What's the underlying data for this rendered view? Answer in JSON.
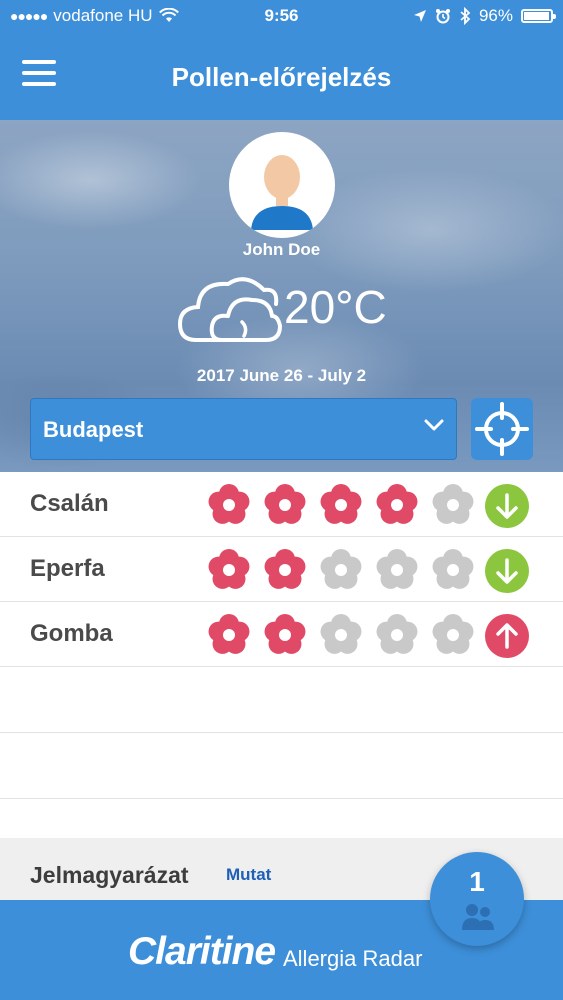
{
  "status_bar": {
    "carrier": "vodafone HU",
    "time": "9:56",
    "battery": "96%",
    "signal_dots": "●●●●●"
  },
  "header": {
    "title": "Pollen-előrejelzés",
    "menu_icon": "hamburger-menu-icon"
  },
  "profile": {
    "name": "John Doe",
    "avatar_icon": "user-avatar-icon"
  },
  "weather": {
    "icon": "cloud-icon",
    "temperature": "20°C",
    "date_range": "2017 June 26 - July 2"
  },
  "location": {
    "selected_city": "Budapest",
    "locate_icon": "crosshair-icon"
  },
  "pollen": {
    "items": [
      {
        "name": "Csalán",
        "level": 4,
        "max_level": 5,
        "trend": "down"
      },
      {
        "name": "Eperfa",
        "level": 2,
        "max_level": 5,
        "trend": "down"
      },
      {
        "name": "Gomba",
        "level": 2,
        "max_level": 5,
        "trend": "up"
      }
    ],
    "colors": {
      "active_flower": "#e04a66",
      "inactive_flower": "#c9c9c9",
      "trend_down": "#8cc63f",
      "trend_up": "#e04a66"
    }
  },
  "legend": {
    "title": "Jelmagyarázat",
    "toggle_label": "Mutat"
  },
  "footer": {
    "brand": "Claritine",
    "product": "Allergia Radar"
  },
  "family": {
    "count": "1",
    "icon": "people-icon"
  },
  "colors": {
    "primary": "#3d8fd9",
    "text": "#4a4a4a"
  }
}
